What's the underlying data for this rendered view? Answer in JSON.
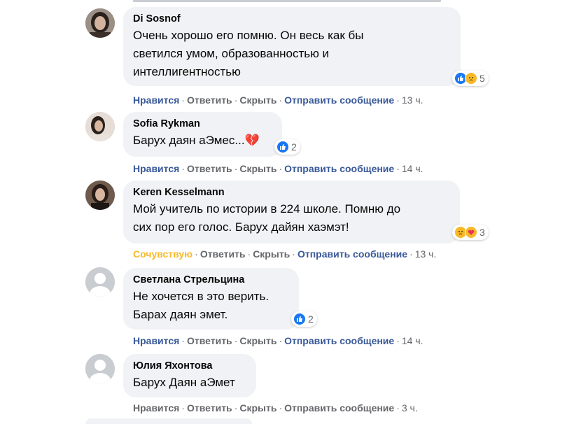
{
  "colors": {
    "bubble": "#f0f2f5",
    "link_blue": "#385898",
    "sympathy_gold": "#f7b928",
    "meta_grey": "#65676b",
    "like_blue": "#1877f2",
    "love_red": "#e8325a",
    "care_yellow": "#f7b928"
  },
  "comments": [
    {
      "author": "Di Sosnof",
      "text": "Очень хорошо его помню. Он весь как бы\nсветился умом, образованностью и\nинтеллигентностью",
      "reactions": {
        "icons": [
          "like-icon",
          "sad-icon"
        ],
        "count": "5"
      },
      "actions": {
        "react": "Нравится",
        "reply": "Ответить",
        "hide": "Скрыть",
        "message": "Отправить сообщение",
        "time": "13 ч."
      }
    },
    {
      "author": "Sofia Rykman",
      "text": "Барух даян аЭмес...💔",
      "reactions": {
        "icons": [
          "like-icon"
        ],
        "count": "2"
      },
      "actions": {
        "react": "Нравится",
        "reply": "Ответить",
        "hide": "Скрыть",
        "message": "Отправить сообщение",
        "time": "14 ч."
      }
    },
    {
      "author": "Keren Kesselmann",
      "text": "Мой учитель по истории в 224 школе. Помню до\nсих пор его голос. Барух дайян хаэмэт!",
      "reactions": {
        "icons": [
          "sad-icon",
          "care-icon"
        ],
        "count": "3"
      },
      "actions": {
        "react": "Сочувствую",
        "reply": "Ответить",
        "hide": "Скрыть",
        "message": "Отправить сообщение",
        "time": "13 ч."
      }
    },
    {
      "author": "Светлана Стрельцина",
      "text": "Не хочется в это верить.\nБарах даян эмет.",
      "reactions": {
        "icons": [
          "like-icon"
        ],
        "count": "2"
      },
      "actions": {
        "react": "Нравится",
        "reply": "Ответить",
        "hide": "Скрыть",
        "message": "Отправить сообщение",
        "time": "14 ч."
      }
    },
    {
      "author": "Юлия Яхонтова",
      "text": "Барух Даян аЭмет",
      "actions": {
        "react": "Нравится",
        "reply": "Ответить",
        "hide": "Скрыть",
        "message": "Отправить сообщение",
        "time": "3 ч."
      }
    }
  ]
}
